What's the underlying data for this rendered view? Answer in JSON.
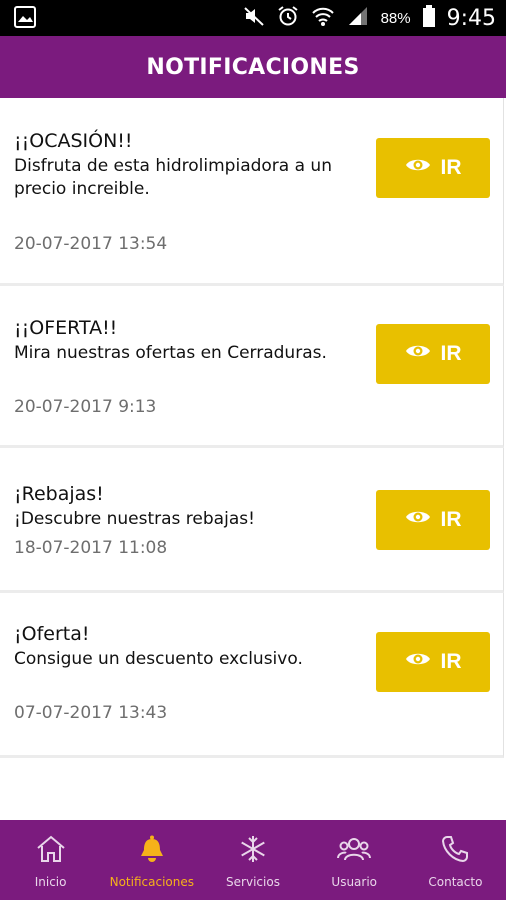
{
  "status_bar": {
    "battery": "88%",
    "time": "9:45",
    "icons": [
      "gallery-icon",
      "mute-icon",
      "alarm-icon",
      "wifi-icon",
      "signal-icon",
      "battery-icon"
    ]
  },
  "header": {
    "title": "NOTIFICACIONES"
  },
  "notifications": [
    {
      "title": "¡¡OCASIÓN!!",
      "body": "Disfruta de esta hidrolimpiadora a un precio increible.",
      "date": "20-07-2017 13:54",
      "button": "IR"
    },
    {
      "title": "¡¡OFERTA!!",
      "body": "Mira nuestras ofertas en Cerraduras.",
      "date": "20-07-2017 9:13",
      "button": "IR"
    },
    {
      "title": "¡Rebajas!",
      "body": "¡Descubre nuestras rebajas!",
      "date": "18-07-2017 11:08",
      "button": "IR"
    },
    {
      "title": "¡Oferta!",
      "body": "Consigue un descuento exclusivo.",
      "date": "07-07-2017 13:43",
      "button": "IR"
    }
  ],
  "bottom_nav": {
    "active": "Notificaciones",
    "items": [
      {
        "label": "Inicio",
        "icon": "home-icon"
      },
      {
        "label": "Notificaciones",
        "icon": "bell-icon"
      },
      {
        "label": "Servicios",
        "icon": "snowflake-icon"
      },
      {
        "label": "Usuario",
        "icon": "users-icon"
      },
      {
        "label": "Contacto",
        "icon": "phone-icon"
      }
    ]
  },
  "colors": {
    "brand_purple": "#7b1b7e",
    "button_yellow": "#e8c000",
    "active_nav": "#f6b21a",
    "date_gray": "#6e6e6e"
  }
}
